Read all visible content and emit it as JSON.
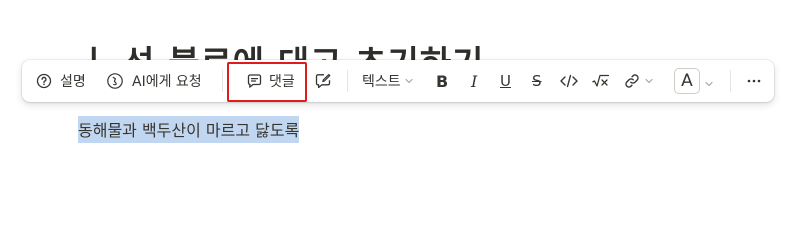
{
  "document": {
    "heading_visible_fragment": "ㅣ 성 블로에 대고 초기하기",
    "selected_text": "동해물과 백두산이 마르고 닳도록"
  },
  "toolbar": {
    "explain_label": "설명",
    "ask_ai_label": "AI에게 요청",
    "comment_label": "댓글",
    "text_style_label": "텍스트",
    "text_color_glyph": "A",
    "icons": {
      "explain": "help-circle-icon",
      "ask_ai": "ai-face-icon",
      "comment": "comment-icon",
      "edit_comment": "edit-comment-icon",
      "bold": "bold-icon",
      "italic": "italic-icon",
      "underline": "underline-icon",
      "strikethrough": "strikethrough-icon",
      "code": "code-icon",
      "math": "math-icon",
      "link": "link-icon",
      "more": "more-horizontal-icon"
    }
  },
  "colors": {
    "selection": "#c1d7f1",
    "highlight_border": "#e01b1b",
    "text": "#37352f"
  }
}
